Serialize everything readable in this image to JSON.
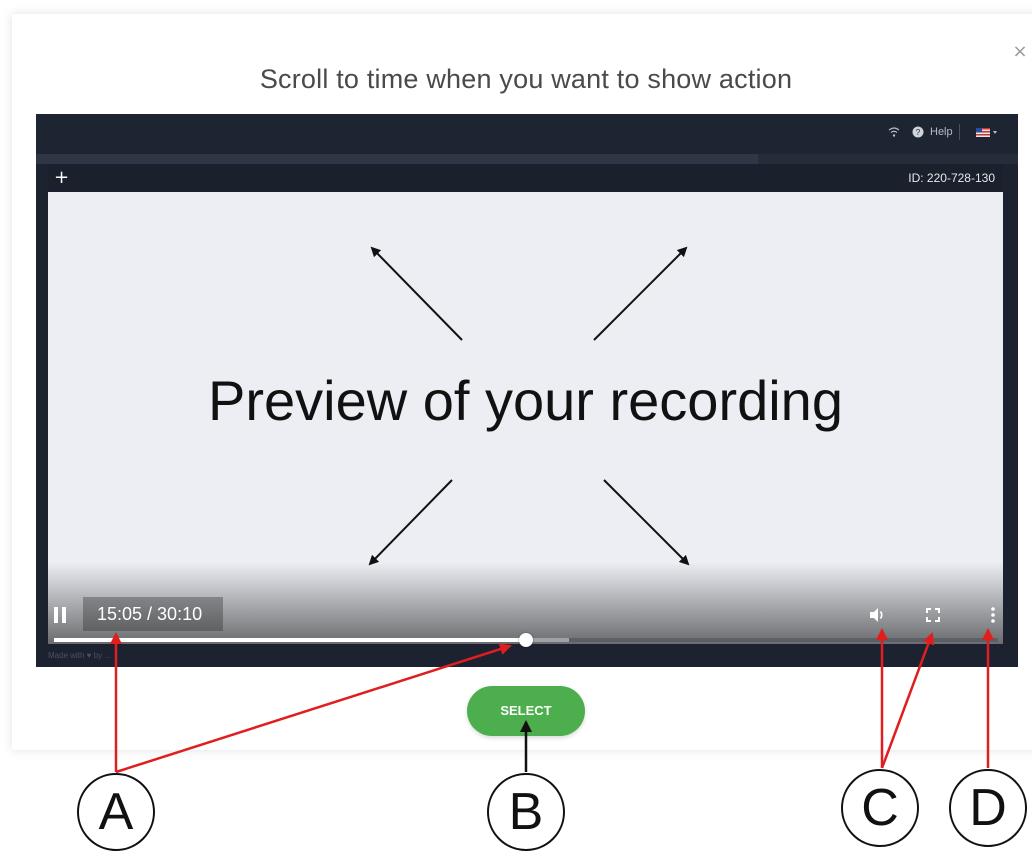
{
  "modal": {
    "title": "Scroll to time when you want to show action",
    "close_glyph": "×"
  },
  "player": {
    "topbar": {
      "wifi_icon": "wifi-icon",
      "help_label": "Help",
      "flag_icon": "us-flag-icon"
    },
    "session_id": "ID: 220-728-130",
    "plus_glyph": "+",
    "preview_text": "Preview of your recording",
    "time_display": "15:05 / 30:10",
    "progress": {
      "current": "15:05",
      "total": "30:10",
      "played_fraction": 0.5
    },
    "footer_note": "Made with ♥ by ..."
  },
  "select_button": {
    "label": "SELECT",
    "color": "#4cae4c"
  },
  "annotations": {
    "A": "A",
    "B": "B",
    "C": "C",
    "D": "D",
    "arrow_color": "#e01e1e"
  }
}
